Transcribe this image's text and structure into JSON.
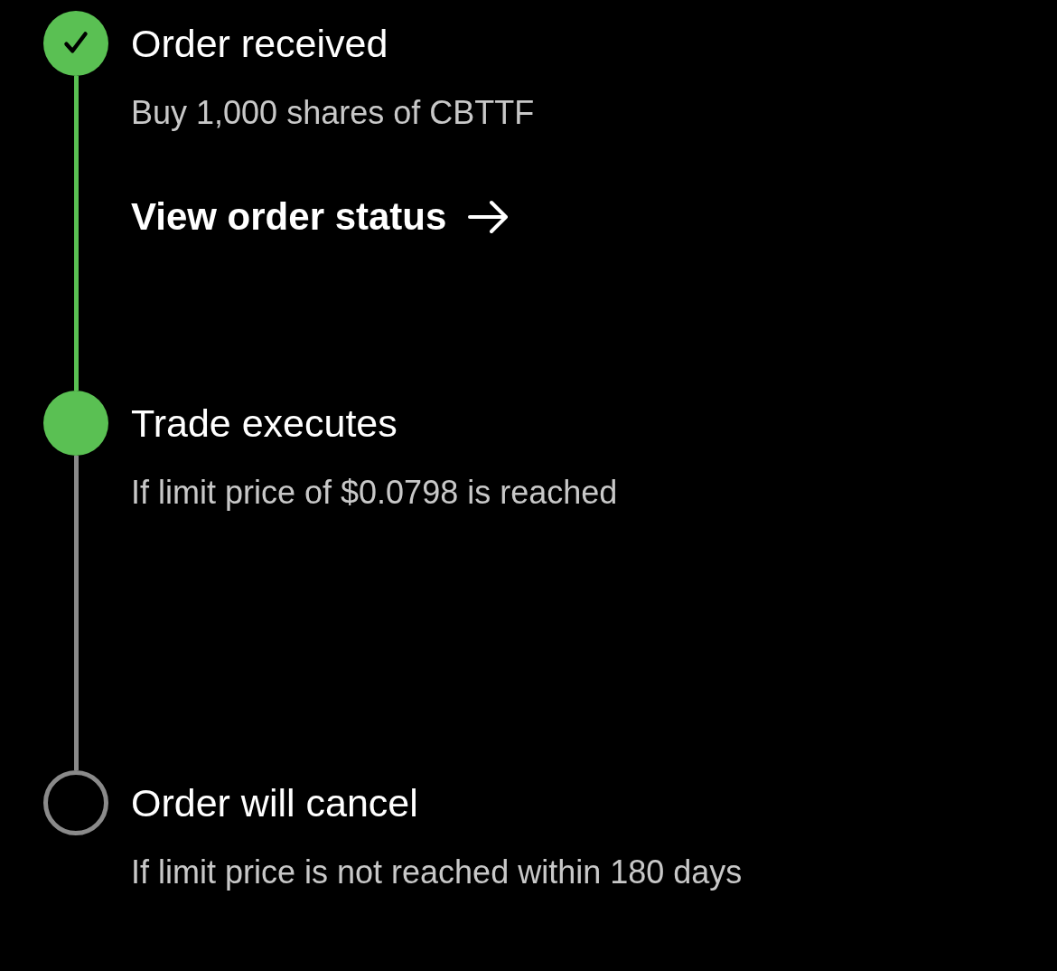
{
  "steps": [
    {
      "kind": "completed",
      "title": "Order received",
      "subtitle": "Buy 1,000 shares of CBTTF",
      "link": "View order status"
    },
    {
      "kind": "current",
      "title": "Trade executes",
      "subtitle": "If limit price of $0.0798 is reached"
    },
    {
      "kind": "pending",
      "title": "Order will cancel",
      "subtitle": "If limit price is not reached within 180 days"
    }
  ]
}
